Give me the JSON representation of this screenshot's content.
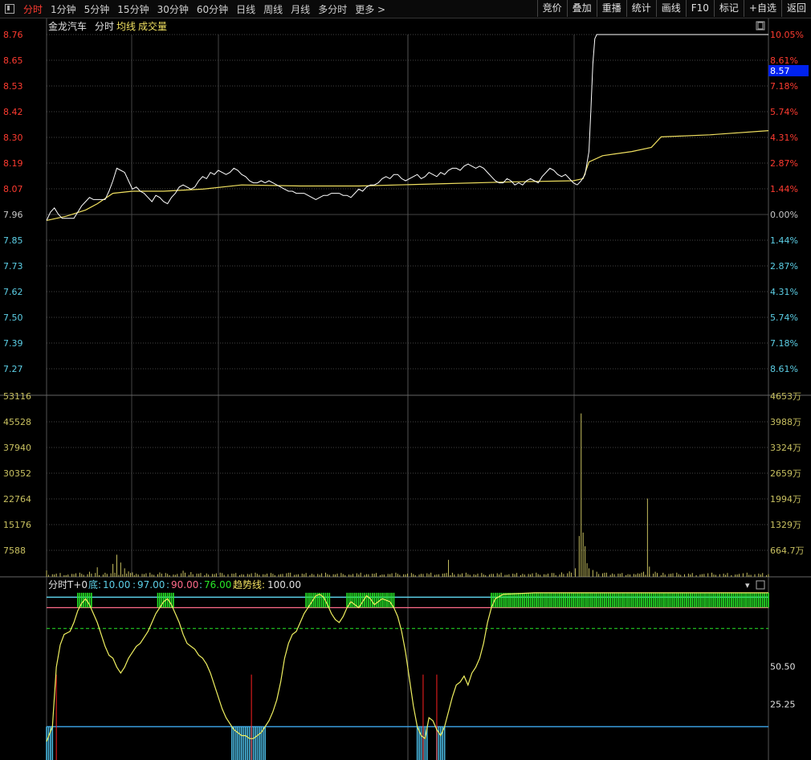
{
  "toolbar": {
    "periods": [
      "分时",
      "1分钟",
      "5分钟",
      "15分钟",
      "30分钟",
      "60分钟",
      "日线",
      "周线",
      "月线",
      "多分时",
      "更多 >"
    ],
    "active": 0,
    "tools": [
      "竞价",
      "叠加",
      "重播",
      "统计",
      "画线",
      "F10",
      "标记",
      "+自选",
      "返回"
    ]
  },
  "header": {
    "stock": "金龙汽车",
    "mode": "分时",
    "avg_label": "均线",
    "vol_label": "成交量"
  },
  "colors": {
    "up": "#ff3b30",
    "down": "#5ccfe6",
    "price": "#ffffff",
    "avg": "#f0e060",
    "vol": "#c8c060",
    "grid": "#444444",
    "green": "#27e827"
  },
  "price_axis": {
    "left": [
      "8.76",
      "8.65",
      "8.53",
      "8.42",
      "8.30",
      "8.19",
      "8.07",
      "7.96",
      "7.85",
      "7.73",
      "7.62",
      "7.50",
      "7.39",
      "7.27"
    ],
    "right": [
      "10.05%",
      "8.61%",
      "7.18%",
      "5.74%",
      "4.31%",
      "2.87%",
      "1.44%",
      "0.00%",
      "1.44%",
      "2.87%",
      "4.31%",
      "5.74%",
      "7.18%",
      "8.61%"
    ],
    "last_price": "8.57"
  },
  "volume_axis": {
    "left": [
      "53116",
      "45528",
      "37940",
      "30352",
      "22764",
      "15176",
      "7588"
    ],
    "right": [
      "4653万",
      "3988万",
      "3324万",
      "2659万",
      "1994万",
      "1329万",
      "664.7万"
    ]
  },
  "indicator": {
    "name": "分时T+0",
    "bottom_label": "底:",
    "params": [
      "10.00",
      "97.00",
      "90.00",
      "76.00"
    ],
    "trend_label": "趋势线:",
    "trend_value": "100.00",
    "axis": [
      "50.50",
      "25.25"
    ],
    "dropdown": "▾"
  },
  "chart_data": {
    "type": "line",
    "price_range": [
      7.16,
      8.76
    ],
    "prev_close": 7.96,
    "price_series": [
      [
        0,
        7.87
      ],
      [
        2,
        7.91
      ],
      [
        4,
        7.93
      ],
      [
        6,
        7.9
      ],
      [
        8,
        7.88
      ],
      [
        10,
        7.88
      ],
      [
        12,
        7.88
      ],
      [
        14,
        7.88
      ],
      [
        16,
        7.91
      ],
      [
        18,
        7.94
      ],
      [
        20,
        7.96
      ],
      [
        22,
        7.98
      ],
      [
        24,
        7.97
      ],
      [
        26,
        7.97
      ],
      [
        28,
        7.97
      ],
      [
        30,
        7.97
      ],
      [
        32,
        8.01
      ],
      [
        34,
        8.06
      ],
      [
        36,
        8.12
      ],
      [
        38,
        8.11
      ],
      [
        40,
        8.1
      ],
      [
        42,
        8.06
      ],
      [
        44,
        8.02
      ],
      [
        46,
        8.03
      ],
      [
        48,
        8.01
      ],
      [
        50,
        8.0
      ],
      [
        52,
        7.98
      ],
      [
        54,
        7.96
      ],
      [
        56,
        7.99
      ],
      [
        58,
        7.98
      ],
      [
        60,
        7.96
      ],
      [
        62,
        7.95
      ],
      [
        64,
        7.98
      ],
      [
        66,
        8.0
      ],
      [
        68,
        8.03
      ],
      [
        70,
        8.04
      ],
      [
        72,
        8.03
      ],
      [
        74,
        8.02
      ],
      [
        76,
        8.03
      ],
      [
        78,
        8.06
      ],
      [
        80,
        8.08
      ],
      [
        82,
        8.07
      ],
      [
        84,
        8.1
      ],
      [
        86,
        8.09
      ],
      [
        88,
        8.11
      ],
      [
        90,
        8.1
      ],
      [
        92,
        8.09
      ],
      [
        94,
        8.1
      ],
      [
        96,
        8.12
      ],
      [
        98,
        8.11
      ],
      [
        100,
        8.09
      ],
      [
        102,
        8.08
      ],
      [
        104,
        8.06
      ],
      [
        106,
        8.05
      ],
      [
        108,
        8.05
      ],
      [
        110,
        8.06
      ],
      [
        112,
        8.05
      ],
      [
        114,
        8.06
      ],
      [
        116,
        8.05
      ],
      [
        118,
        8.04
      ],
      [
        120,
        8.03
      ],
      [
        122,
        8.02
      ],
      [
        124,
        8.01
      ],
      [
        126,
        8.01
      ],
      [
        128,
        8.0
      ],
      [
        130,
        8.0
      ],
      [
        132,
        8.0
      ],
      [
        134,
        7.99
      ],
      [
        136,
        7.98
      ],
      [
        138,
        7.97
      ],
      [
        140,
        7.98
      ],
      [
        142,
        7.99
      ],
      [
        144,
        7.99
      ],
      [
        146,
        8.0
      ],
      [
        148,
        8.0
      ],
      [
        150,
        8.0
      ],
      [
        152,
        7.99
      ],
      [
        154,
        7.99
      ],
      [
        156,
        7.98
      ],
      [
        158,
        8.0
      ],
      [
        160,
        8.02
      ],
      [
        162,
        8.01
      ],
      [
        164,
        8.03
      ],
      [
        166,
        8.04
      ],
      [
        168,
        8.04
      ],
      [
        170,
        8.05
      ],
      [
        172,
        8.07
      ],
      [
        174,
        8.08
      ],
      [
        176,
        8.07
      ],
      [
        178,
        8.09
      ],
      [
        180,
        8.09
      ],
      [
        182,
        8.07
      ],
      [
        184,
        8.06
      ],
      [
        186,
        8.07
      ],
      [
        188,
        8.08
      ],
      [
        190,
        8.09
      ],
      [
        192,
        8.07
      ],
      [
        194,
        8.08
      ],
      [
        196,
        8.1
      ],
      [
        198,
        8.09
      ],
      [
        200,
        8.08
      ],
      [
        202,
        8.1
      ],
      [
        204,
        8.09
      ],
      [
        206,
        8.11
      ],
      [
        208,
        8.12
      ],
      [
        210,
        8.12
      ],
      [
        212,
        8.11
      ],
      [
        214,
        8.13
      ],
      [
        216,
        8.14
      ],
      [
        218,
        8.13
      ],
      [
        220,
        8.12
      ],
      [
        222,
        8.13
      ],
      [
        224,
        8.12
      ],
      [
        226,
        8.1
      ],
      [
        228,
        8.08
      ],
      [
        230,
        8.06
      ],
      [
        232,
        8.05
      ],
      [
        234,
        8.05
      ],
      [
        236,
        8.07
      ],
      [
        238,
        8.06
      ],
      [
        240,
        8.04
      ],
      [
        242,
        8.05
      ],
      [
        244,
        8.04
      ],
      [
        246,
        8.06
      ],
      [
        248,
        8.07
      ],
      [
        250,
        8.06
      ],
      [
        252,
        8.05
      ],
      [
        254,
        8.08
      ],
      [
        256,
        8.1
      ],
      [
        258,
        8.12
      ],
      [
        260,
        8.11
      ],
      [
        262,
        8.09
      ],
      [
        264,
        8.08
      ],
      [
        266,
        8.09
      ],
      [
        268,
        8.07
      ],
      [
        270,
        8.05
      ],
      [
        272,
        8.04
      ]
    ],
    "price_spike": [
      [
        272,
        8.04
      ],
      [
        274,
        8.06
      ],
      [
        276,
        8.09
      ],
      [
        278,
        8.2
      ],
      [
        279,
        8.4
      ],
      [
        280,
        8.62
      ],
      [
        281,
        8.74
      ],
      [
        282,
        8.76
      ],
      [
        330,
        8.76
      ],
      [
        370,
        8.76
      ]
    ],
    "avg_series": [
      [
        0,
        7.87
      ],
      [
        10,
        7.89
      ],
      [
        20,
        7.92
      ],
      [
        26,
        7.95
      ],
      [
        34,
        8.0
      ],
      [
        44,
        8.01
      ],
      [
        60,
        8.01
      ],
      [
        80,
        8.02
      ],
      [
        100,
        8.04
      ],
      [
        130,
        8.035
      ],
      [
        160,
        8.035
      ],
      [
        200,
        8.045
      ],
      [
        240,
        8.055
      ],
      [
        270,
        8.06
      ],
      [
        275,
        8.07
      ],
      [
        278,
        8.15
      ],
      [
        285,
        8.18
      ],
      [
        300,
        8.2
      ],
      [
        310,
        8.22
      ],
      [
        315,
        8.27
      ],
      [
        340,
        8.28
      ],
      [
        370,
        8.3
      ]
    ],
    "vol_range": [
      0,
      53116
    ],
    "volume": [
      [
        0,
        1900
      ],
      [
        4,
        700
      ],
      [
        10,
        500
      ],
      [
        14,
        800
      ],
      [
        18,
        900
      ],
      [
        22,
        1500
      ],
      [
        26,
        2800
      ],
      [
        30,
        1200
      ],
      [
        34,
        3800
      ],
      [
        36,
        6500
      ],
      [
        38,
        4200
      ],
      [
        40,
        2500
      ],
      [
        42,
        1600
      ],
      [
        44,
        1300
      ],
      [
        46,
        900
      ],
      [
        50,
        800
      ],
      [
        54,
        700
      ],
      [
        58,
        1300
      ],
      [
        62,
        900
      ],
      [
        66,
        600
      ],
      [
        70,
        1800
      ],
      [
        74,
        1400
      ],
      [
        78,
        900
      ],
      [
        82,
        1000
      ],
      [
        86,
        800
      ],
      [
        90,
        1100
      ],
      [
        96,
        900
      ],
      [
        100,
        800
      ],
      [
        104,
        700
      ],
      [
        108,
        900
      ],
      [
        112,
        700
      ],
      [
        116,
        900
      ],
      [
        120,
        800
      ],
      [
        124,
        1200
      ],
      [
        128,
        700
      ],
      [
        132,
        800
      ],
      [
        136,
        900
      ],
      [
        140,
        600
      ],
      [
        144,
        800
      ],
      [
        148,
        700
      ],
      [
        152,
        800
      ],
      [
        156,
        600
      ],
      [
        160,
        700
      ],
      [
        164,
        800
      ],
      [
        168,
        900
      ],
      [
        172,
        700
      ],
      [
        176,
        800
      ],
      [
        180,
        900
      ],
      [
        184,
        700
      ],
      [
        188,
        800
      ],
      [
        192,
        900
      ],
      [
        196,
        800
      ],
      [
        200,
        700
      ],
      [
        204,
        1000
      ],
      [
        206,
        5000
      ],
      [
        208,
        1200
      ],
      [
        212,
        700
      ],
      [
        216,
        800
      ],
      [
        220,
        600
      ],
      [
        224,
        700
      ],
      [
        228,
        900
      ],
      [
        232,
        700
      ],
      [
        236,
        600
      ],
      [
        240,
        800
      ],
      [
        244,
        900
      ],
      [
        248,
        700
      ],
      [
        252,
        800
      ],
      [
        256,
        700
      ],
      [
        260,
        1100
      ],
      [
        264,
        1300
      ],
      [
        268,
        1600
      ],
      [
        271,
        2500
      ],
      [
        273,
        12000
      ],
      [
        274,
        48000
      ],
      [
        275,
        13000
      ],
      [
        276,
        9000
      ],
      [
        277,
        4000
      ],
      [
        278,
        2500
      ],
      [
        280,
        2000
      ],
      [
        282,
        1500
      ],
      [
        286,
        1200
      ],
      [
        290,
        1000
      ],
      [
        294,
        900
      ],
      [
        298,
        800
      ],
      [
        302,
        700
      ],
      [
        304,
        900
      ],
      [
        306,
        1500
      ],
      [
        308,
        23000
      ],
      [
        309,
        3000
      ],
      [
        312,
        1500
      ],
      [
        316,
        1200
      ],
      [
        320,
        900
      ],
      [
        324,
        800
      ],
      [
        330,
        700
      ],
      [
        336,
        800
      ],
      [
        342,
        700
      ],
      [
        348,
        600
      ],
      [
        354,
        700
      ],
      [
        360,
        600
      ],
      [
        366,
        700
      ],
      [
        370,
        800
      ]
    ],
    "indicator_range": [
      0,
      101
    ],
    "t0_series": [
      [
        0,
        0
      ],
      [
        3,
        10
      ],
      [
        5,
        50
      ],
      [
        7,
        65
      ],
      [
        9,
        72
      ],
      [
        12,
        74
      ],
      [
        14,
        80
      ],
      [
        16,
        88
      ],
      [
        18,
        93
      ],
      [
        20,
        96
      ],
      [
        22,
        92
      ],
      [
        24,
        86
      ],
      [
        26,
        80
      ],
      [
        28,
        72
      ],
      [
        30,
        64
      ],
      [
        32,
        58
      ],
      [
        34,
        56
      ],
      [
        36,
        50
      ],
      [
        38,
        46
      ],
      [
        40,
        50
      ],
      [
        42,
        56
      ],
      [
        44,
        60
      ],
      [
        46,
        64
      ],
      [
        48,
        66
      ],
      [
        50,
        70
      ],
      [
        52,
        74
      ],
      [
        54,
        80
      ],
      [
        56,
        86
      ],
      [
        58,
        90
      ],
      [
        60,
        94
      ],
      [
        62,
        96
      ],
      [
        64,
        92
      ],
      [
        66,
        86
      ],
      [
        68,
        80
      ],
      [
        70,
        72
      ],
      [
        72,
        66
      ],
      [
        74,
        64
      ],
      [
        76,
        62
      ],
      [
        78,
        58
      ],
      [
        80,
        56
      ],
      [
        82,
        52
      ],
      [
        84,
        46
      ],
      [
        86,
        38
      ],
      [
        88,
        30
      ],
      [
        90,
        22
      ],
      [
        92,
        16
      ],
      [
        94,
        12
      ],
      [
        96,
        8
      ],
      [
        98,
        6
      ],
      [
        100,
        4
      ],
      [
        102,
        4
      ],
      [
        104,
        2
      ],
      [
        106,
        2
      ],
      [
        108,
        4
      ],
      [
        110,
        6
      ],
      [
        112,
        10
      ],
      [
        114,
        14
      ],
      [
        116,
        20
      ],
      [
        118,
        28
      ],
      [
        120,
        40
      ],
      [
        122,
        56
      ],
      [
        124,
        66
      ],
      [
        126,
        72
      ],
      [
        128,
        74
      ],
      [
        130,
        80
      ],
      [
        132,
        86
      ],
      [
        134,
        90
      ],
      [
        136,
        94
      ],
      [
        138,
        98
      ],
      [
        140,
        99
      ],
      [
        142,
        97
      ],
      [
        144,
        92
      ],
      [
        146,
        86
      ],
      [
        148,
        82
      ],
      [
        150,
        80
      ],
      [
        152,
        84
      ],
      [
        154,
        90
      ],
      [
        156,
        94
      ],
      [
        158,
        92
      ],
      [
        160,
        90
      ],
      [
        162,
        94
      ],
      [
        164,
        98
      ],
      [
        166,
        96
      ],
      [
        168,
        92
      ],
      [
        170,
        94
      ],
      [
        172,
        96
      ],
      [
        174,
        95
      ],
      [
        176,
        94
      ],
      [
        178,
        90
      ],
      [
        180,
        84
      ],
      [
        182,
        74
      ],
      [
        184,
        60
      ],
      [
        186,
        42
      ],
      [
        188,
        24
      ],
      [
        190,
        10
      ],
      [
        192,
        4
      ],
      [
        194,
        2
      ],
      [
        196,
        16
      ],
      [
        198,
        14
      ],
      [
        200,
        8
      ],
      [
        202,
        4
      ],
      [
        204,
        10
      ],
      [
        206,
        20
      ],
      [
        208,
        30
      ],
      [
        210,
        38
      ],
      [
        212,
        40
      ],
      [
        214,
        44
      ],
      [
        216,
        38
      ],
      [
        218,
        46
      ],
      [
        220,
        50
      ],
      [
        222,
        56
      ],
      [
        224,
        66
      ],
      [
        226,
        80
      ],
      [
        228,
        90
      ],
      [
        230,
        96
      ],
      [
        234,
        99
      ],
      [
        250,
        100
      ],
      [
        370,
        100
      ]
    ],
    "levels": {
      "bottom": 10.0,
      "top_cyan": 97.0,
      "red": 90.0,
      "green": 76.0
    },
    "red_spikes": [
      [
        5,
        45
      ],
      [
        105,
        45
      ],
      [
        193,
        45
      ],
      [
        200,
        45
      ]
    ]
  }
}
